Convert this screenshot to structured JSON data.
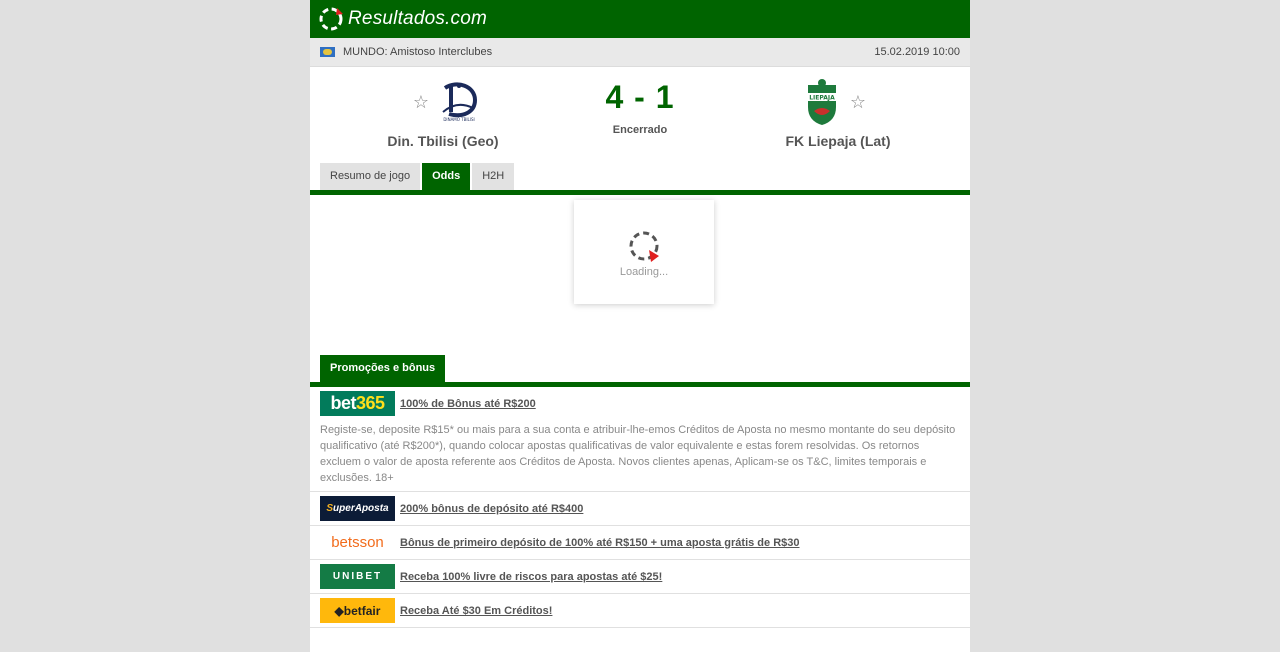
{
  "header": {
    "logo_text": "Resultados.com",
    "brand_color": "#006400"
  },
  "match_info": {
    "competition": "MUNDO: Amistoso Interclubes",
    "datetime": "15.02.2019 10:00"
  },
  "match": {
    "home_team": "Din. Tbilisi (Geo)",
    "away_team": "FK Liepaja (Lat)",
    "score": "4 - 1",
    "status": "Encerrado",
    "home_logo_text": "DINAMO TBILISI",
    "away_logo_text": "LIEPAJA"
  },
  "tabs": [
    {
      "label": "Resumo de jogo",
      "active": false
    },
    {
      "label": "Odds",
      "active": true
    },
    {
      "label": "H2H",
      "active": false
    }
  ],
  "loading": {
    "text": "Loading..."
  },
  "promotions": {
    "tab_label": "Promoções e bônus",
    "items": [
      {
        "brand": "bet365",
        "title": "100% de Bônus até R$200",
        "description": "Registe-se, deposite R$15* ou mais para a sua conta e atribuir-lhe-emos Créditos de Aposta no mesmo montante do seu depósito qualificativo (até R$200*), quando colocar apostas qualificativas de valor equivalente e estas forem resolvidas. Os retornos excluem o valor de aposta referente aos Créditos de Aposta. Novos clientes apenas, Aplicam-se os T&C, limites temporais e exclusões. 18+"
      },
      {
        "brand": "SuperAposta",
        "title": "200% bônus de depósito até R$400"
      },
      {
        "brand": "betsson",
        "title": "Bônus de primeiro depósito de 100% até R$150 + uma aposta grátis de R$30"
      },
      {
        "brand": "UNIBET",
        "title": "Receba 100% livre de riscos para apostas até $25!"
      },
      {
        "brand": "betfair",
        "title": "Receba Até $30 Em Créditos!"
      }
    ]
  }
}
